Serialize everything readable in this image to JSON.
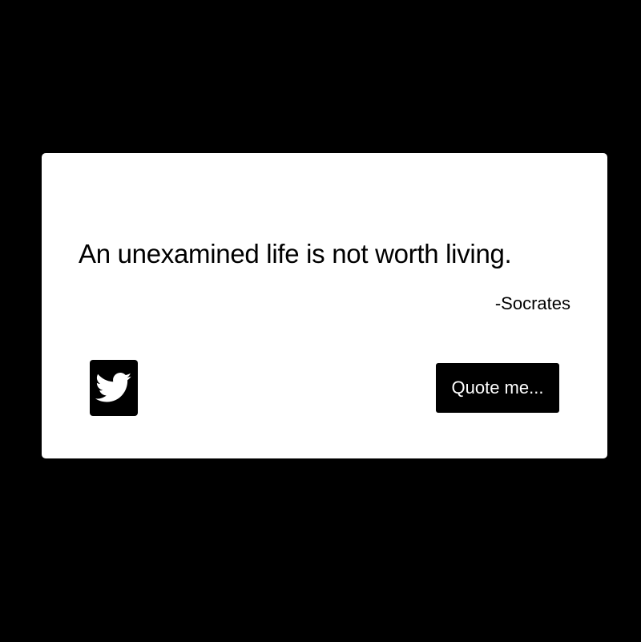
{
  "quote": {
    "text": "An unexamined life is not worth living.",
    "author": "-Socrates"
  },
  "actions": {
    "tweet_icon": "twitter-bird-icon",
    "new_quote_label": "Quote me..."
  },
  "colors": {
    "background": "#000000",
    "card": "#ffffff",
    "text": "#000000",
    "button": "#000000",
    "button_text": "#ffffff"
  }
}
